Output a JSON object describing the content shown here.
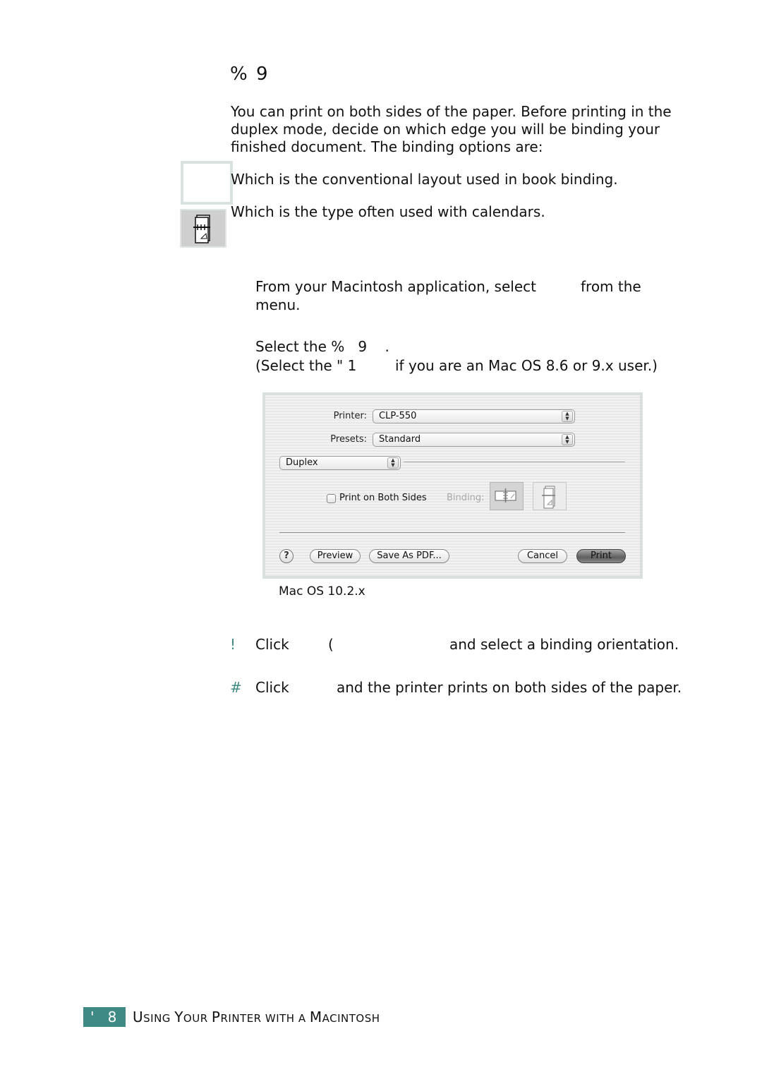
{
  "section": {
    "heading": "%   9",
    "intro": "You can print on both sides of the paper. Before printing in the duplex mode, decide on which edge you will be binding your finished document. The binding options are:",
    "binding_options": [
      {
        "icon": "long-edge-binding-icon",
        "text": "Which is the conventional layout used in book binding."
      },
      {
        "icon": "short-edge-binding-icon",
        "text": "Which is the type often used with calendars."
      }
    ]
  },
  "steps": {
    "step1": {
      "text_a": "From your Macintosh application, select",
      "text_b": "from the",
      "text_c": "menu."
    },
    "step2": {
      "line1": "Select the %   9    .",
      "line2_a": "(Select the \" 1",
      "line2_b": "if you are an Mac OS 8.6 or 9.x user.)"
    },
    "step3": {
      "marker": "!",
      "click": "Click",
      "paren": "(",
      "rest": "and select a binding orientation."
    },
    "step4": {
      "marker": "#",
      "click": "Click",
      "rest": "and the printer prints on both sides of the paper."
    }
  },
  "dialog": {
    "printer_label": "Printer:",
    "printer_value": "CLP-550",
    "presets_label": "Presets:",
    "presets_value": "Standard",
    "panel_value": "Duplex",
    "checkbox_label": "Print on Both Sides",
    "checkbox_checked": false,
    "binding_label": "Binding:",
    "help_label": "?",
    "preview_label": "Preview",
    "save_pdf_label": "Save As PDF...",
    "cancel_label": "Cancel",
    "print_label": "Print",
    "arrows_glyph": "▲▼"
  },
  "caption": "Mac OS 10.2.x",
  "footer": {
    "page_badge": "'   8",
    "title_parts": [
      {
        "big": "U",
        "small": "SING "
      },
      {
        "big": "Y",
        "small": "OUR "
      },
      {
        "big": "P",
        "small": "RINTER WITH A "
      },
      {
        "big": "M",
        "small": "ACINTOSH"
      }
    ]
  }
}
